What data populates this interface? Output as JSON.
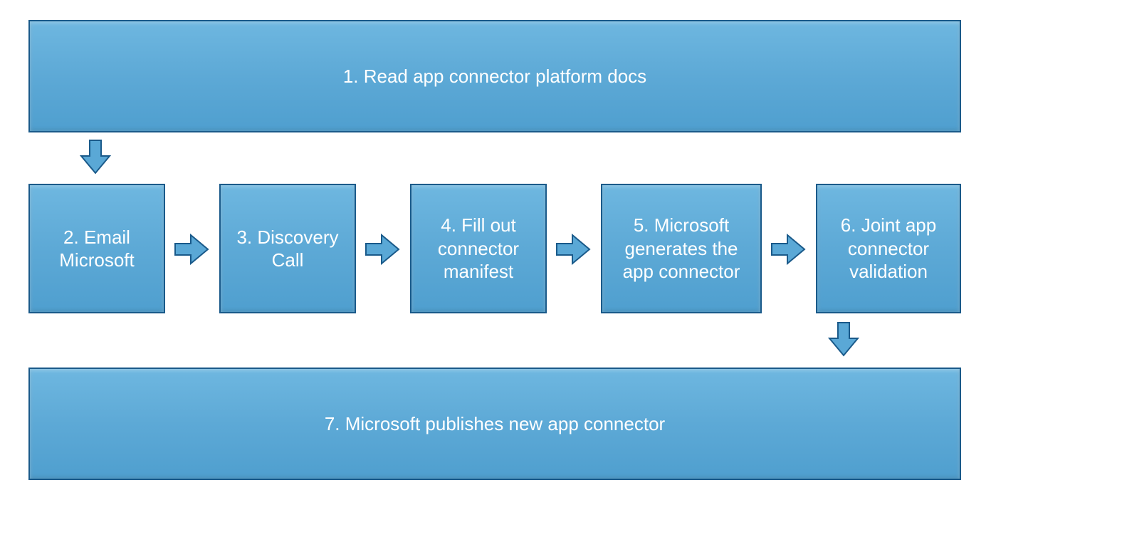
{
  "steps": {
    "s1": "1. Read app connector platform docs",
    "s2": "2. Email Microsoft",
    "s3": "3. Discovery Call",
    "s4": "4. Fill out connector manifest",
    "s5": "5. Microsoft generates the app connector",
    "s6": "6. Joint app connector validation",
    "s7": "7. Microsoft publishes new app connector"
  },
  "colors": {
    "box_fill": "#5aa8d6",
    "box_border": "#1a5a8a",
    "text": "#ffffff"
  }
}
